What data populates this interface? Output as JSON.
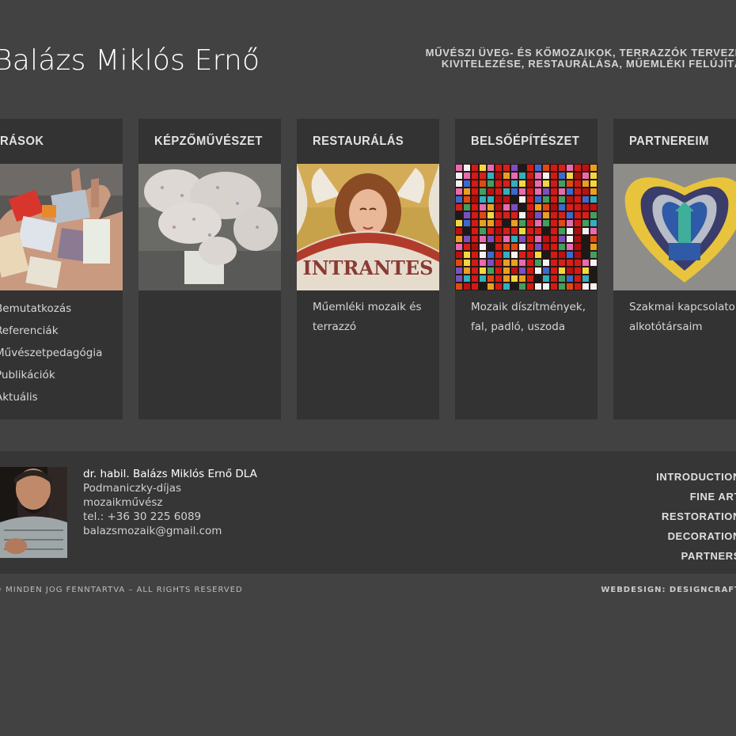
{
  "header": {
    "title": "Balázs Miklós Ernő",
    "tagline_line1": "MŰVÉSZI ÜVEG- ÉS KŐMOZAIKOK, TERRAZZÓK TERVEZÉ",
    "tagline_line2": "KIVITELEZÉSE, RESTAURÁLÁSA, MŰEMLÉKI FELÚJÍTÁ"
  },
  "cards": [
    {
      "title": "RÁSOK",
      "image": "hand-holding-stones-image",
      "links": [
        "Bemutatkozás",
        "Referenciák",
        "Művészetpedagógia",
        "Publikációk",
        "Aktuális"
      ]
    },
    {
      "title": "KÉPZŐMŰVÉSZET",
      "image": "stone-sculpture-image",
      "description": ""
    },
    {
      "title": "RESTAURÁLÁS",
      "image": "intrantes-angel-mosaic-image",
      "image_text": "INTRANTES",
      "description": "Műemléki mozaik és terrazzó"
    },
    {
      "title": "BELSŐÉPÍTÉSZET",
      "image": "glass-tile-mosaic-image",
      "description": "Mozaik díszítmények, fal, padló, uszoda"
    },
    {
      "title": "PARTNEREIM",
      "image": "heart-mosaic-image",
      "description": "Szakmai kapcsolato alkotótársaim"
    }
  ],
  "footer": {
    "portrait": "artist-portrait-image",
    "name": "dr. habil. Balázs Miklós Ernő DLA",
    "line2": "Podmaniczky-díjas",
    "line3": "mozaikművész",
    "phone": "tel.: +36 30 225 6089",
    "email": "balazsmozaik@gmail.com",
    "nav": [
      "INTRODUCTION",
      "FINE ART",
      "RESTORATION",
      "DECORATION",
      "PARTNERS"
    ]
  },
  "bottom": {
    "copyright": "© MINDEN JOG FENNTARTVA – ALL RIGHTS RESERVED",
    "credit": "WEBDESIGN: DESIGNCRAFT"
  },
  "colors": {
    "page_background": "#434242",
    "card_background": "#343333",
    "footer_background": "#373636"
  }
}
